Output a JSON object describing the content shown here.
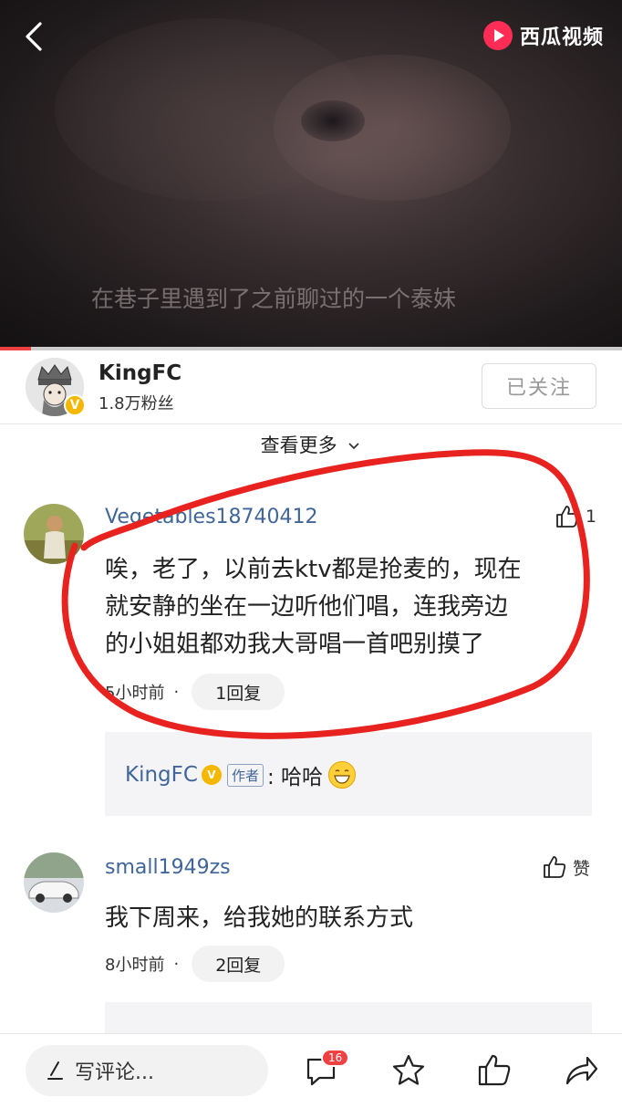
{
  "header": {
    "logo_text": "西瓜视频",
    "subtitle": "在巷子里遇到了之前聊过的一个泰妹",
    "progress": 0.05
  },
  "author": {
    "name": "KingFC",
    "fans": "1.8万粉丝",
    "follow_label": "已关注",
    "verified": "V"
  },
  "more_label": "查看更多",
  "comments": [
    {
      "user": "Vegetables18740412",
      "lines": [
        "唉，老了，以前去ktv都是抢麦的，现在",
        "就安静的坐在一边听他们唱，连我旁边",
        "的小姐姐都劝我大哥唱一首吧别摸了"
      ],
      "time": "5小时前",
      "dot": "·",
      "reply_count": "1回复",
      "like": "1",
      "reply": {
        "name": "KingFC",
        "tag": "作者",
        "text": ": 哈哈"
      }
    },
    {
      "user": "small1949zs",
      "lines": [
        "我下周来，给我她的联系方式"
      ],
      "time": "8小时前",
      "dot": "·",
      "reply_count": "2回复",
      "like": "赞"
    }
  ],
  "bottom": {
    "write_placeholder": "写评论...",
    "comment_count": "16"
  },
  "colors": {
    "accent": "#f04142",
    "username": "#406599",
    "annotation": "#e8231f"
  }
}
